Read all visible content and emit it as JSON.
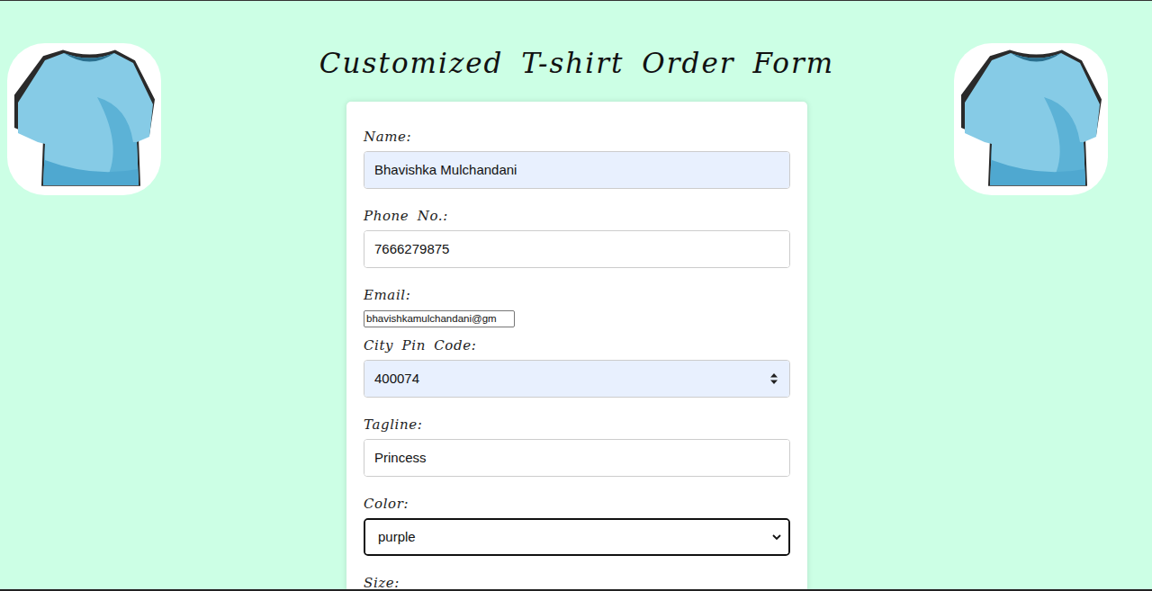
{
  "title": "Customized T-shirt Order Form",
  "form": {
    "fields": [
      {
        "label": "Name:",
        "value": "Bhavishka Mulchandani",
        "kind": "text",
        "autofilled": true,
        "focused": false
      },
      {
        "label": "Phone  No.:",
        "value": "7666279875",
        "kind": "text",
        "autofilled": false,
        "focused": false
      },
      {
        "label": "Email:",
        "value": "bhavishkamulchandani@gm",
        "kind": "small",
        "autofilled": false,
        "focused": false
      },
      {
        "label": "City  Pin  Code:",
        "value": "400074",
        "kind": "number",
        "autofilled": true,
        "focused": false
      },
      {
        "label": "Tagline:",
        "value": "Princess",
        "kind": "text",
        "autofilled": false,
        "focused": false
      },
      {
        "label": "Color:",
        "value": "purple",
        "kind": "select",
        "autofilled": false,
        "focused": true
      }
    ],
    "next_label": "Size:"
  }
}
